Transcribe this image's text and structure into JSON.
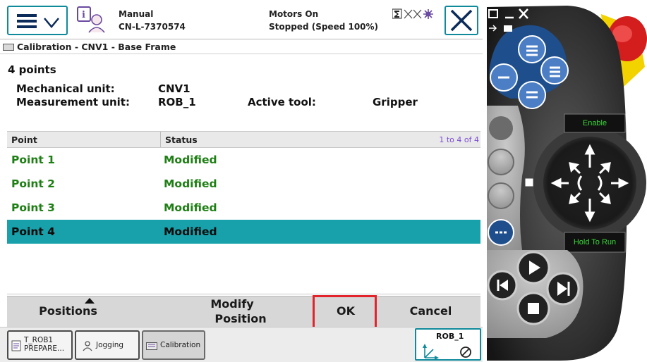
{
  "header": {
    "mode": "Manual",
    "controller": "CN-L-7370574",
    "motors": "Motors On",
    "run_status": "Stopped (Speed 100%)"
  },
  "window": {
    "title": "Calibration - CNV1 - Base Frame"
  },
  "info": {
    "points_count": "4 points",
    "mech_unit_label": "Mechanical unit:",
    "mech_unit_value": "CNV1",
    "meas_unit_label": "Measurement unit:",
    "meas_unit_value": "ROB_1",
    "active_tool_label": "Active tool:",
    "active_tool_value": "Gripper"
  },
  "grid": {
    "columns": [
      "Point",
      "Status"
    ],
    "range": "1 to 4 of 4",
    "rows": [
      {
        "point": "Point  1",
        "status": "Modified",
        "selected": false
      },
      {
        "point": "Point  2",
        "status": "Modified",
        "selected": false
      },
      {
        "point": "Point  3",
        "status": "Modified",
        "selected": false
      },
      {
        "point": "Point  4",
        "status": "Modified",
        "selected": true
      }
    ]
  },
  "commands": {
    "positions": "Positions",
    "modify_line1": "Modify",
    "modify_line2": "Position",
    "ok": "OK",
    "cancel": "Cancel"
  },
  "taskbar": {
    "task1_line1": "T_ROB1",
    "task1_line2": "PREPARE...",
    "jogging": "Jogging",
    "calibration": "Calibration",
    "rob": "ROB_1"
  },
  "pendant": {
    "enable": "Enable",
    "hold_to_run": "Hold To Run"
  },
  "colors": {
    "accent_teal": "#18a1aa",
    "status_green": "#1e7f14",
    "highlight_red": "#e3232b",
    "pendant_blue": "#1f4e8c",
    "emergency_red": "#d41e1e",
    "emergency_yellow": "#f2d300"
  }
}
